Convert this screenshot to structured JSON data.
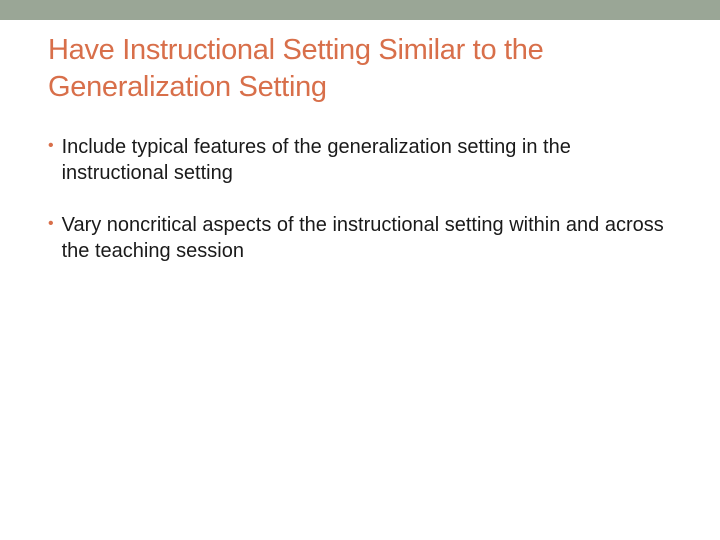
{
  "slide": {
    "title": "Have Instructional Setting Similar to the Generalization Setting",
    "bullets": [
      {
        "text": "Include typical features of the generalization setting in the instructional setting"
      },
      {
        "text": "Vary noncritical aspects of the instructional setting within and across the teaching session"
      }
    ]
  },
  "colors": {
    "accent": "#d86f4a",
    "topbar": "#9aa696"
  }
}
